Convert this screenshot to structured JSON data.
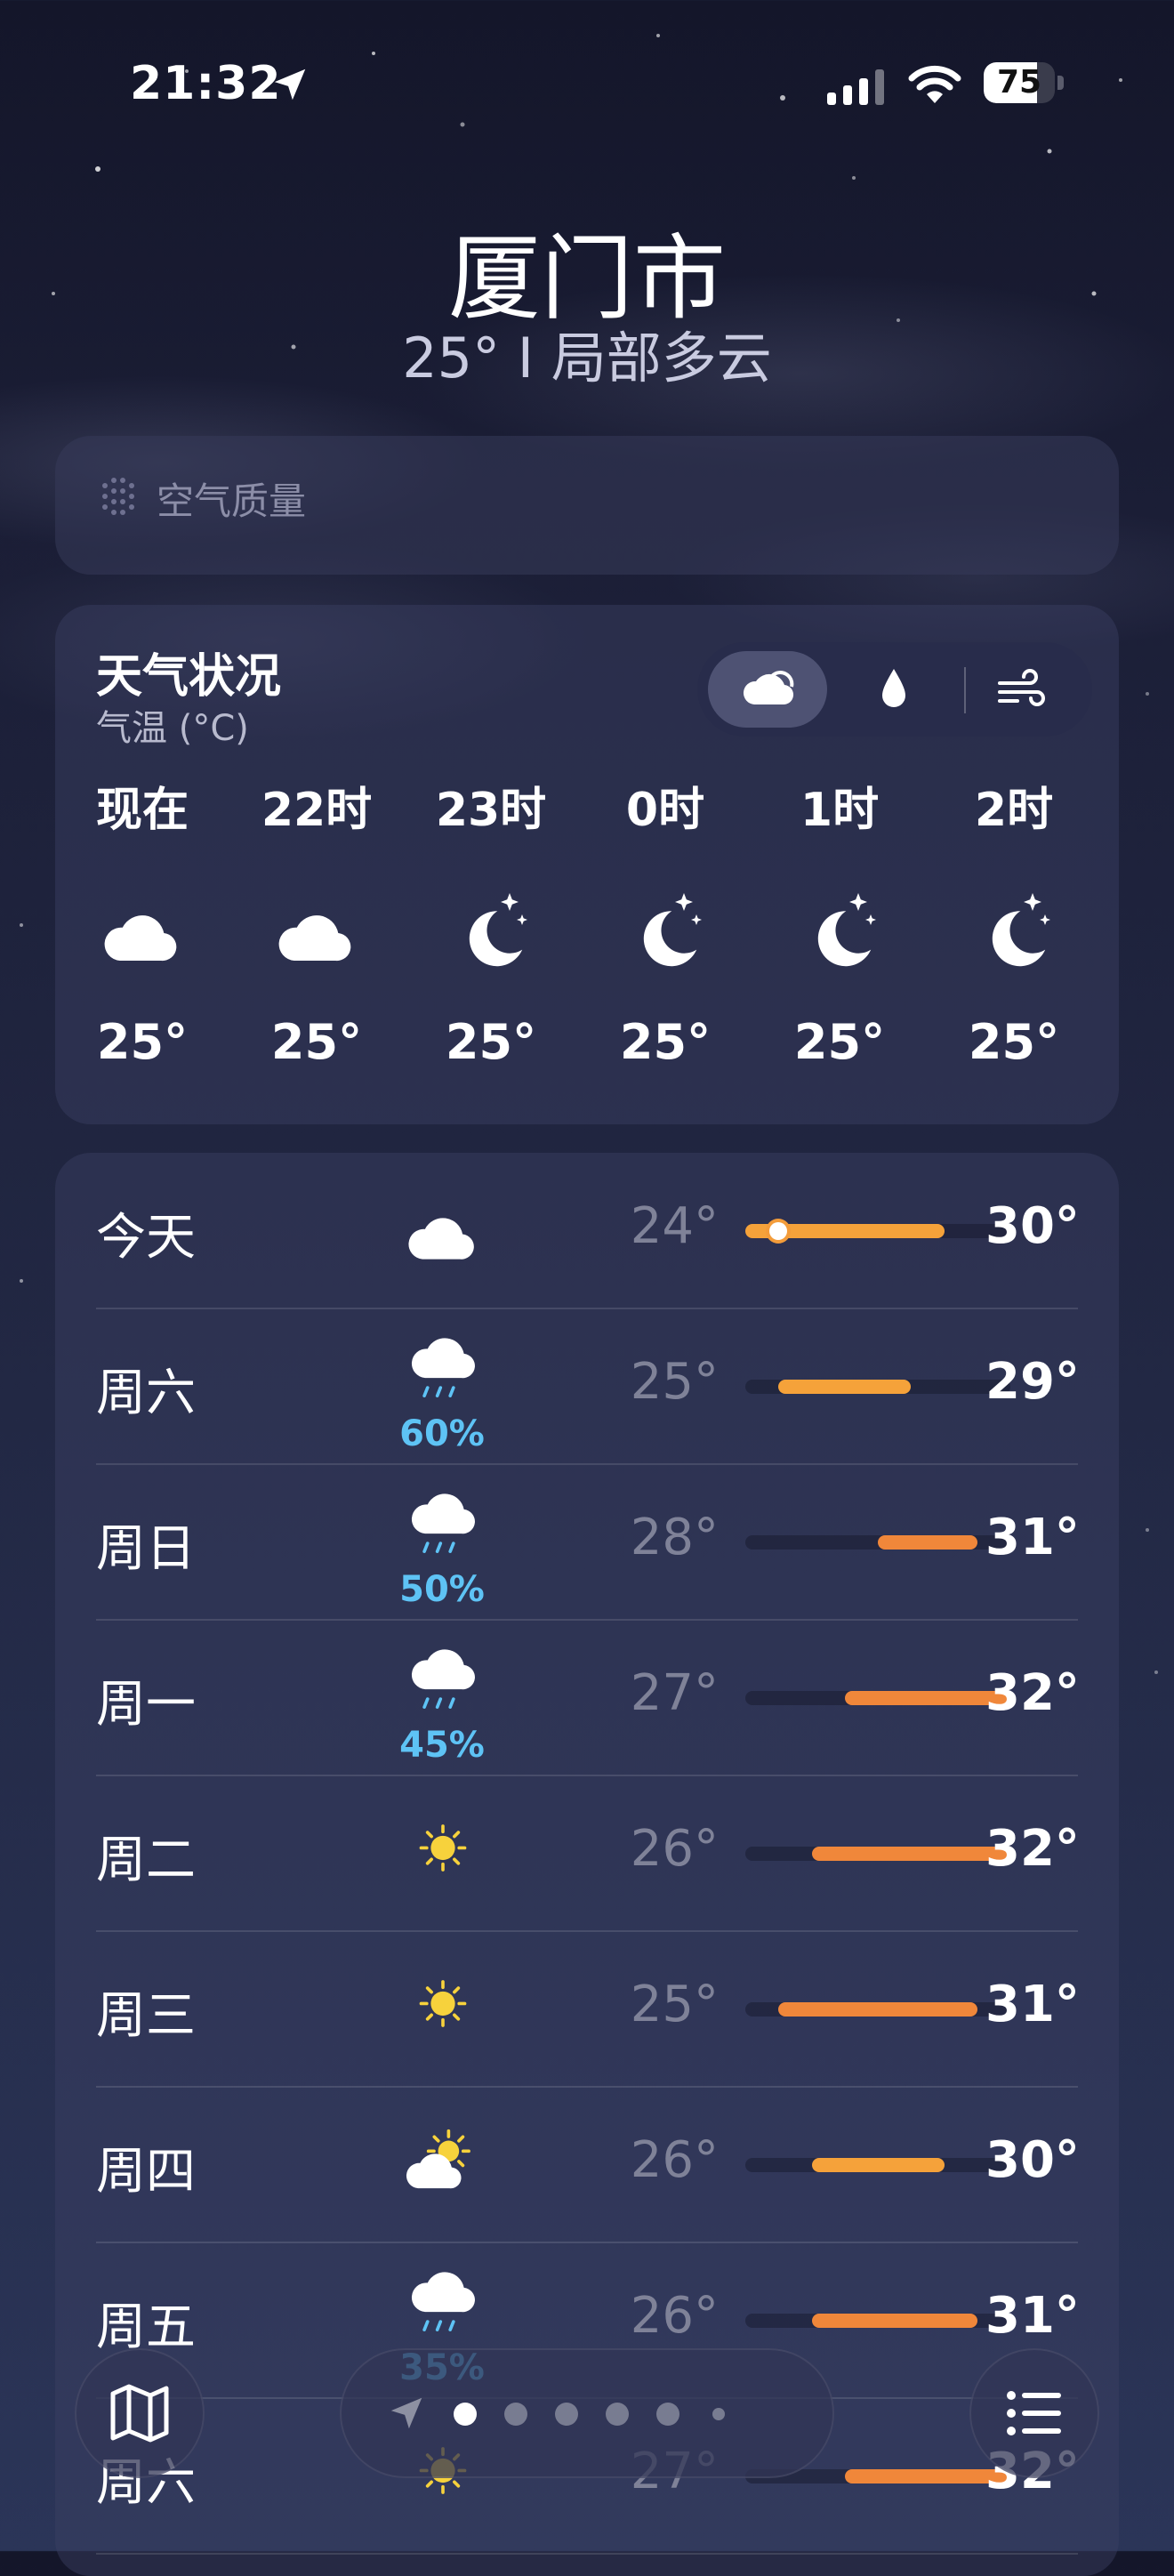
{
  "status_bar": {
    "time": "21:32",
    "battery": "75",
    "battery_level": 0.75
  },
  "header": {
    "city": "厦门市",
    "subtitle": "25° I 局部多云"
  },
  "air_quality": {
    "label": "空气质量"
  },
  "hourly": {
    "title": "天气状况",
    "subtitle": "气温 (°C)",
    "tabs": [
      "cloud-icon",
      "drop-icon",
      "wind-icon"
    ],
    "items": [
      {
        "label": "现在",
        "icon": "cloud-moon",
        "temp": "25°"
      },
      {
        "label": "22时",
        "icon": "cloud-moon",
        "temp": "25°"
      },
      {
        "label": "23时",
        "icon": "moon-stars",
        "temp": "25°"
      },
      {
        "label": "0时",
        "icon": "moon-stars",
        "temp": "25°"
      },
      {
        "label": "1时",
        "icon": "moon-stars",
        "temp": "25°"
      },
      {
        "label": "2时",
        "icon": "moon-stars",
        "temp": "25°"
      }
    ]
  },
  "daily": {
    "range": [
      24,
      32
    ],
    "items": [
      {
        "day": "今天",
        "icon": "cloud-moon",
        "pct": "",
        "low": "24°",
        "high": "30°",
        "low_val": 24,
        "high_val": 30,
        "current": 25
      },
      {
        "day": "周六",
        "icon": "cloud-rain",
        "pct": "60%",
        "low": "25°",
        "high": "29°",
        "low_val": 25,
        "high_val": 29
      },
      {
        "day": "周日",
        "icon": "cloud-rain",
        "pct": "50%",
        "low": "28°",
        "high": "31°",
        "low_val": 28,
        "high_val": 31
      },
      {
        "day": "周一",
        "icon": "cloud-rain",
        "pct": "45%",
        "low": "27°",
        "high": "32°",
        "low_val": 27,
        "high_val": 32
      },
      {
        "day": "周二",
        "icon": "sun",
        "pct": "",
        "low": "26°",
        "high": "32°",
        "low_val": 26,
        "high_val": 32
      },
      {
        "day": "周三",
        "icon": "sun",
        "pct": "",
        "low": "25°",
        "high": "31°",
        "low_val": 25,
        "high_val": 31
      },
      {
        "day": "周四",
        "icon": "sun-cloud",
        "pct": "",
        "low": "26°",
        "high": "30°",
        "low_val": 26,
        "high_val": 30
      },
      {
        "day": "周五",
        "icon": "cloud-rain",
        "pct": "35%",
        "low": "26°",
        "high": "31°",
        "low_val": 26,
        "high_val": 31
      },
      {
        "day": "周六",
        "icon": "sun",
        "pct": "",
        "low": "27°",
        "high": "32°",
        "low_val": 27,
        "high_val": 32
      }
    ]
  },
  "bottom_bar": {
    "map_icon": "map-icon",
    "list_icon": "list-icon",
    "pages": 7,
    "active_page": 1
  },
  "colors": {
    "bar_warm": "#f5a23a",
    "bar_hot": "#f0873a",
    "rain": "#5ec3f5",
    "sun": "#f7d23c"
  }
}
